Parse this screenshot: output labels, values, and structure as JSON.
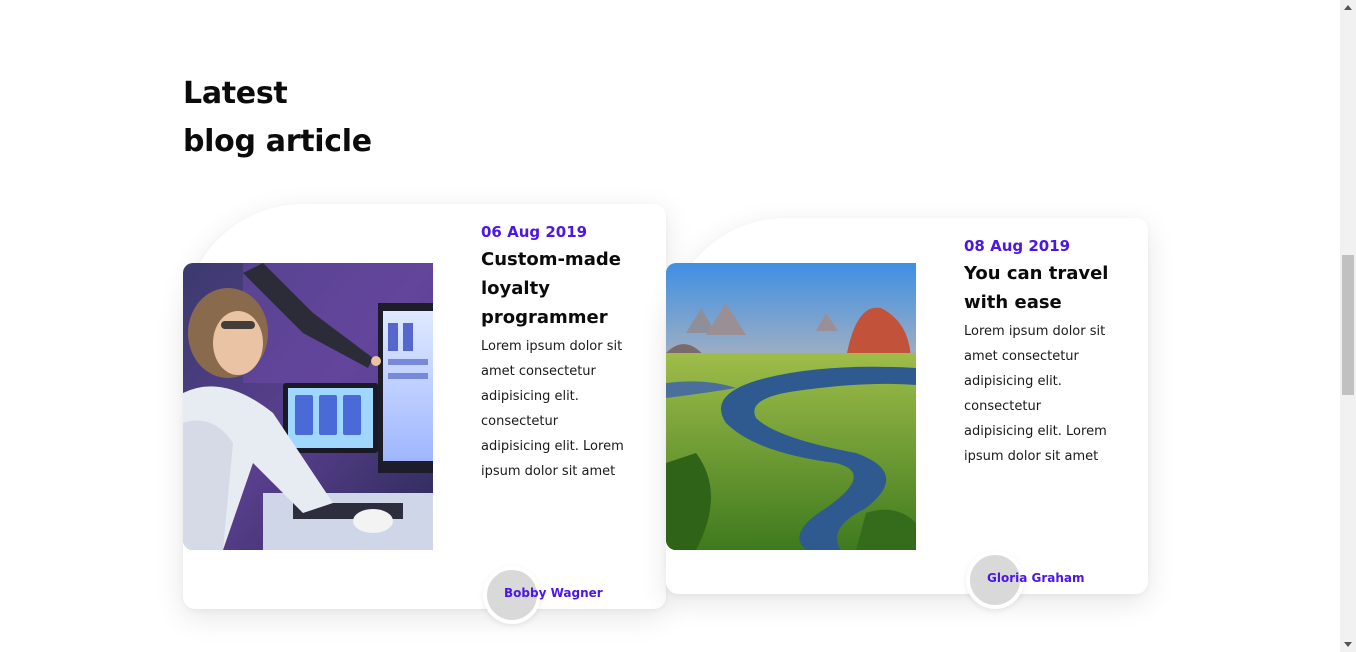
{
  "section": {
    "title_line1": "Latest",
    "title_line2": "blog article"
  },
  "articles": [
    {
      "date": "06 Aug 2019",
      "title": "Custom-made loyalty programmer",
      "excerpt": "Lorem ipsum dolor sit amet consectetur adipisicing elit. consectetur adipisicing elit. Lorem ipsum dolor sit amet",
      "author": "Bobby Wagner",
      "image": "woman-at-computer-photo"
    },
    {
      "date": "08 Aug 2019",
      "title": "You can travel with ease",
      "excerpt": "Lorem ipsum dolor sit amet consectetur adipisicing elit. consectetur adipisicing elit. Lorem ipsum dolor sit amet",
      "author": "Gloria Graham",
      "image": "river-landscape-photo"
    }
  ],
  "colors": {
    "accent": "#4b17e6",
    "heading": "#0b0b0b",
    "avatar": "#d9d9d9"
  }
}
